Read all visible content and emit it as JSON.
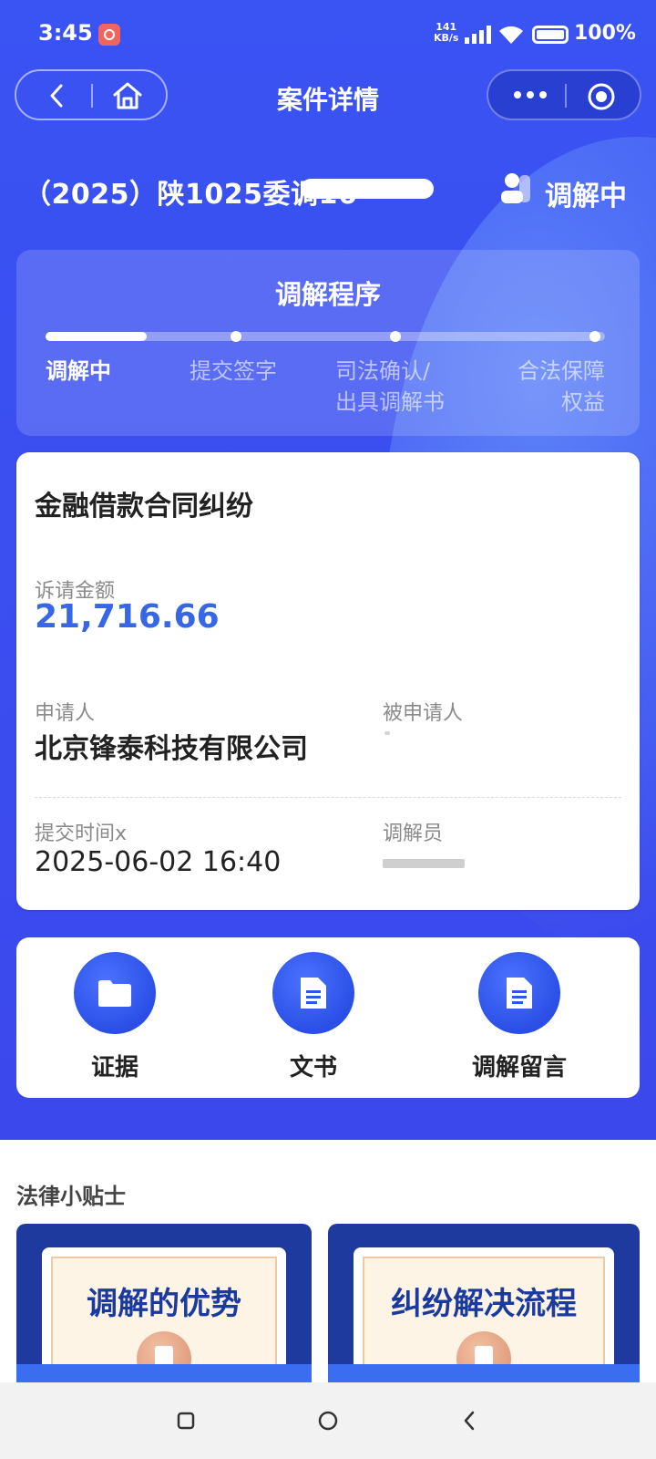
{
  "status_bar": {
    "time": "3:45",
    "net_speed_value": "141",
    "net_speed_unit": "KB/s",
    "battery": "100%"
  },
  "nav": {
    "title": "案件详情",
    "back_icon": "chevron-left-icon",
    "home_icon": "home-icon",
    "more_icon": "more-dots-icon",
    "close_icon": "target-close-icon"
  },
  "case": {
    "number": "（2025）陕1025委调16",
    "status": "调解中"
  },
  "procedure": {
    "title": "调解程序",
    "progress": 0.18,
    "steps": [
      {
        "label": "调解中",
        "active": true
      },
      {
        "label": "提交签字",
        "active": false
      },
      {
        "label": "司法确认/\n出具调解书",
        "active": false
      },
      {
        "label": "合法保障\n权益",
        "active": false
      }
    ]
  },
  "info": {
    "case_type": "金融借款合同纠纷",
    "amount_label": "诉请金额",
    "amount_value": "21,716.66",
    "applicant_label": "申请人",
    "applicant_value": "北京锋泰科技有限公司",
    "respondent_label": "被申请人",
    "submit_time_label": "提交时间x",
    "submit_time_value": "2025-06-02 16:40",
    "mediator_label": "调解员"
  },
  "actions": [
    {
      "label": "证据",
      "icon": "folder-icon"
    },
    {
      "label": "文书",
      "icon": "document-icon"
    },
    {
      "label": "调解留言",
      "icon": "document-icon"
    }
  ],
  "tips": {
    "title": "法律小贴士",
    "cards": [
      {
        "label": "调解的优势"
      },
      {
        "label": "纠纷解决流程"
      }
    ]
  },
  "colors": {
    "hero_blue": "#3a53f3",
    "accent_amount": "#3767e6",
    "tip_text": "#1b3aa0"
  }
}
